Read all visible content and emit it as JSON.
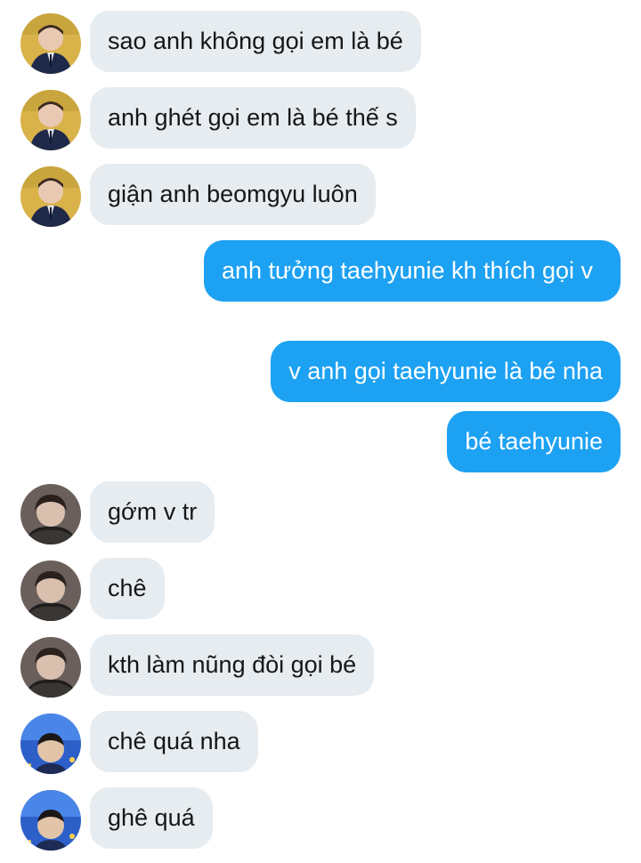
{
  "conversation": {
    "messages": [
      {
        "direction": "incoming",
        "avatar": "avatar-a-icon",
        "text": "sao anh không gọi em là bé"
      },
      {
        "direction": "incoming",
        "avatar": "avatar-a-icon",
        "text": "anh ghét gọi em là bé thế s"
      },
      {
        "direction": "incoming",
        "avatar": "avatar-a-icon",
        "text": "giận anh beomgyu luôn"
      },
      {
        "direction": "outgoing",
        "text": "anh tưởng taehyunie kh thích gọi v"
      },
      {
        "direction": "outgoing",
        "text": "v anh gọi taehyunie là bé nha"
      },
      {
        "direction": "outgoing",
        "text": "bé taehyunie"
      },
      {
        "direction": "incoming",
        "avatar": "avatar-b-icon",
        "text": "gớm v tr"
      },
      {
        "direction": "incoming",
        "avatar": "avatar-b-icon",
        "text": "chê"
      },
      {
        "direction": "incoming",
        "avatar": "avatar-b-icon",
        "text": "kth làm nũng đòi gọi bé"
      },
      {
        "direction": "incoming",
        "avatar": "avatar-c-icon",
        "text": "chê quá nha"
      },
      {
        "direction": "incoming",
        "avatar": "avatar-c-icon",
        "text": "ghê quá"
      }
    ]
  },
  "colors": {
    "incoming_bubble": "#e6ecf0",
    "incoming_text": "#14171a",
    "outgoing_bubble": "#1da1f2",
    "outgoing_text": "#ffffff"
  }
}
